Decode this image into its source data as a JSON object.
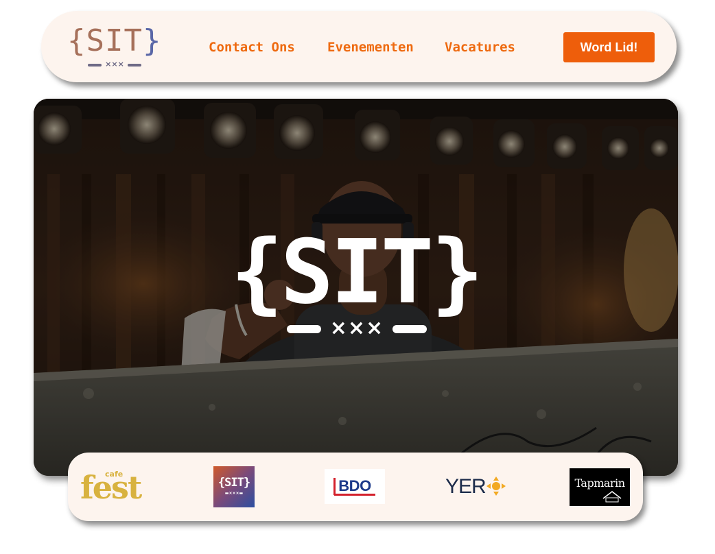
{
  "navbar": {
    "logo": {
      "brace_open": "{",
      "letters": "SIT",
      "brace_close": "}",
      "mark": "×××"
    },
    "links": [
      {
        "label": "Contact Ons"
      },
      {
        "label": "Evenementen"
      },
      {
        "label": "Vacatures"
      }
    ],
    "cta_label": "Word Lid!"
  },
  "hero": {
    "logo_text": "{SIT}",
    "logo_mark": "×××",
    "image": "dj-performing-on-stage-photo"
  },
  "partners": [
    {
      "name": "cafe fest",
      "small": "cafe",
      "word": "fest"
    },
    {
      "name": "SIT",
      "text": "{SIT}",
      "mark": "▬×××▬"
    },
    {
      "name": "BDO",
      "text": "BDO"
    },
    {
      "name": "YER",
      "text": "YER"
    },
    {
      "name": "Tapmarin",
      "text": "Tapmarin"
    }
  ],
  "colors": {
    "accent": "#ee5e0b",
    "nav_link": "#ee6a10",
    "panel_bg": "#fdf4ee",
    "logo_brown": "#a6705a",
    "logo_blue": "#5a67a7",
    "fest_gold": "#d8b23f",
    "bdo_blue": "#1d3a8a",
    "bdo_red": "#d3202b",
    "yer_navy": "#1c2b4a",
    "yer_orange": "#f2a922"
  }
}
